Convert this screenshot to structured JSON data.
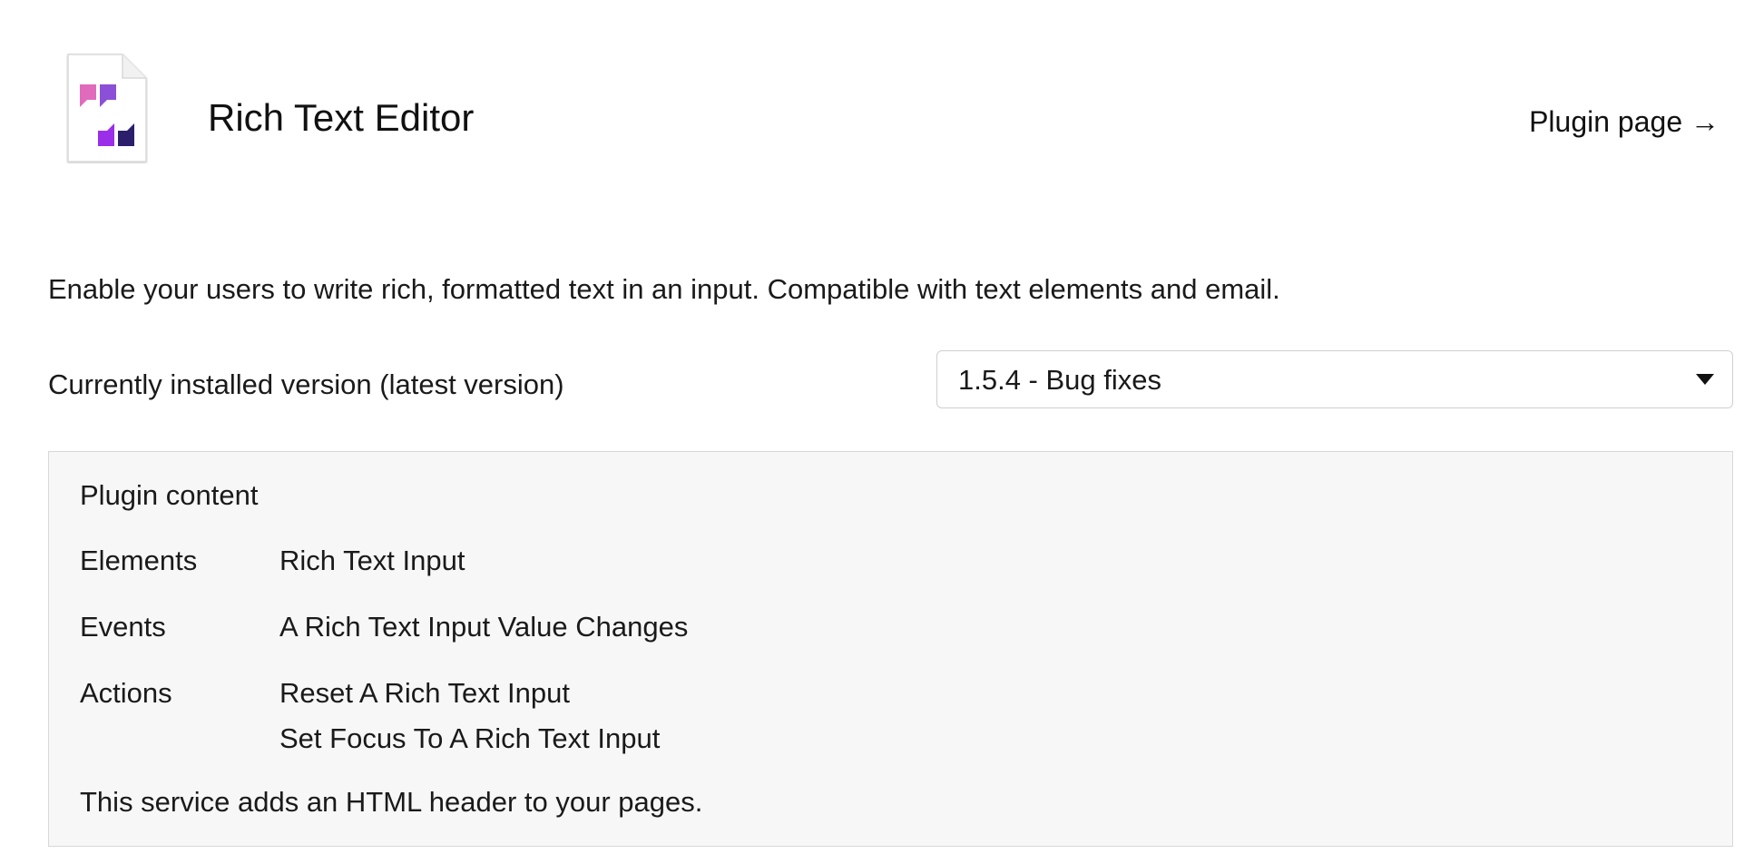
{
  "plugin": {
    "title": "Rich Text Editor",
    "page_link": "Plugin page →",
    "description": "Enable your users to write rich, formatted text in an input. Compatible with text elements and email.",
    "icon": "rich-text-editor-plugin-icon",
    "icon_colors": [
      "#e06bbd",
      "#8b4fd8",
      "#9b2ee8",
      "#2b1f6b"
    ]
  },
  "version": {
    "label": "Currently installed version (latest version)",
    "selected": "1.5.4 - Bug fixes"
  },
  "content": {
    "title": "Plugin content",
    "elements_label": "Elements",
    "elements": [
      "Rich Text Input"
    ],
    "events_label": "Events",
    "events": [
      "A Rich Text Input Value Changes"
    ],
    "actions_label": "Actions",
    "actions": [
      "Reset A Rich Text Input",
      "Set Focus To A Rich Text Input"
    ],
    "note": "This service adds an HTML header to your pages."
  }
}
